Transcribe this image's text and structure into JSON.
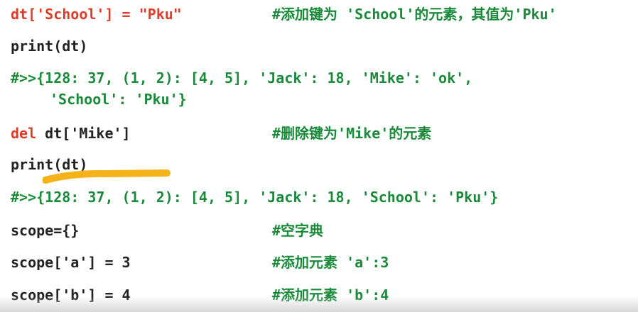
{
  "code": {
    "l1_red": "dt['School'] = \"Pku\"",
    "l1_comment": "#添加键为 'School'的元素，其值为'Pku'",
    "l2": "print(dt)",
    "l3a": "#>>{128: 37, (1, 2): [4, 5], 'Jack': 18, 'Mike': 'ok',",
    "l3b": "'School': 'Pku'}",
    "l4_del": "del",
    "l4_rest": " dt['Mike']",
    "l4_comment": "#删除键为'Mike'的元素",
    "l5": "print(dt)",
    "l6": "#>>{128: 37, (1, 2): [4, 5], 'Jack': 18, 'School': 'Pku'}",
    "l7": "scope={}",
    "l7_comment": "#空字典",
    "l8": "scope['a'] = 3",
    "l8_comment": "#添加元素 'a':3",
    "l9": "scope['b'] = 4",
    "l9_comment": "#添加元素 'b':4"
  },
  "colors": {
    "keyword_red": "#e03c28",
    "code_dark": "#222222",
    "comment_green": "#1a8a3a",
    "highlight_stroke": "#f5b31a"
  }
}
